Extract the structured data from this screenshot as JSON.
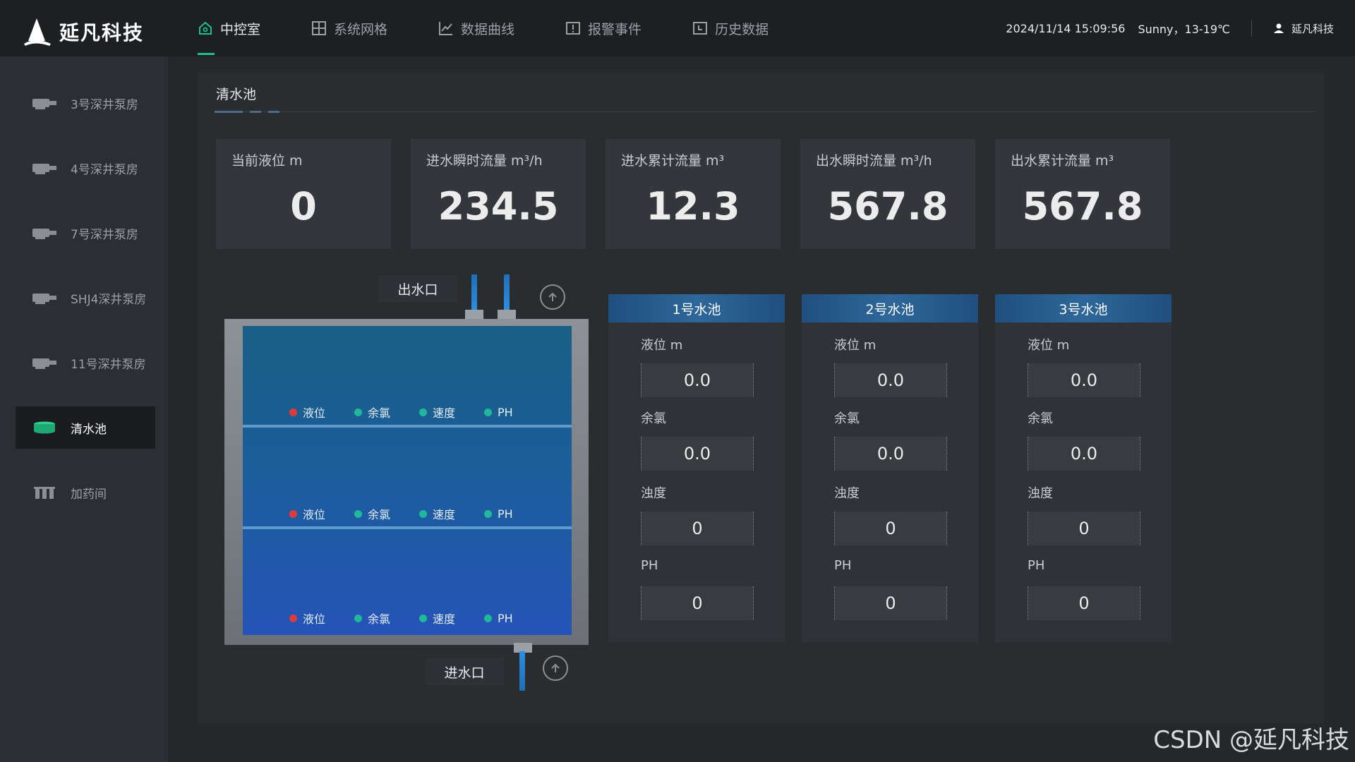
{
  "header": {
    "brand": "延凡科技",
    "nav": [
      {
        "label": "中控室",
        "icon": "home-icon",
        "active": true
      },
      {
        "label": "系统网格",
        "icon": "grid-icon",
        "active": false
      },
      {
        "label": "数据曲线",
        "icon": "line-chart-icon",
        "active": false
      },
      {
        "label": "报警事件",
        "icon": "alarm-icon",
        "active": false
      },
      {
        "label": "历史数据",
        "icon": "history-icon",
        "active": false
      }
    ],
    "datetime": "2024/11/14 15:09:56",
    "weather": "Sunny，13-19℃",
    "user": "延凡科技"
  },
  "sidebar": {
    "items": [
      {
        "label": "3号深井泵房",
        "icon": "pump-icon",
        "active": false
      },
      {
        "label": "4号深井泵房",
        "icon": "pump-icon",
        "active": false
      },
      {
        "label": "7号深井泵房",
        "icon": "pump-icon",
        "active": false
      },
      {
        "label": "SHJ4深井泵房",
        "icon": "pump-icon",
        "active": false
      },
      {
        "label": "11号深井泵房",
        "icon": "pump-icon",
        "active": false
      },
      {
        "label": "清水池",
        "icon": "pool-icon",
        "active": true
      },
      {
        "label": "加药间",
        "icon": "dosing-icon",
        "active": false
      }
    ]
  },
  "main": {
    "title": "清水池",
    "stats": [
      {
        "label": "当前液位 m",
        "value": "0"
      },
      {
        "label": "进水瞬时流量 m³/h",
        "value": "234.5"
      },
      {
        "label": "进水累计流量 m³",
        "value": "12.3"
      },
      {
        "label": "出水瞬时流量 m³/h",
        "value": "567.8"
      },
      {
        "label": "出水累计流量 m³",
        "value": "567.8"
      }
    ],
    "tank": {
      "outlet_label": "出水口",
      "inlet_label": "进水口",
      "legend": [
        "液位",
        "余氯",
        "速度",
        "PH"
      ]
    },
    "pools": [
      {
        "name": "1号水池",
        "metrics": [
          {
            "label": "液位 m",
            "value": "0.0"
          },
          {
            "label": "余氯",
            "value": "0.0"
          },
          {
            "label": "浊度",
            "value": "0"
          },
          {
            "label": "PH",
            "value": "0"
          }
        ]
      },
      {
        "name": "2号水池",
        "metrics": [
          {
            "label": "液位 m",
            "value": "0.0"
          },
          {
            "label": "余氯",
            "value": "0.0"
          },
          {
            "label": "浊度",
            "value": "0"
          },
          {
            "label": "PH",
            "value": "0"
          }
        ]
      },
      {
        "name": "3号水池",
        "metrics": [
          {
            "label": "液位 m",
            "value": "0.0"
          },
          {
            "label": "余氯",
            "value": "0.0"
          },
          {
            "label": "浊度",
            "value": "0"
          },
          {
            "label": "PH",
            "value": "0"
          }
        ]
      }
    ]
  },
  "watermark": "CSDN @延凡科技",
  "colors": {
    "accent": "#21c08b",
    "pool_header": "#2e679a",
    "legend_level": "#e03b3b",
    "legend_chlorine": "#1fb89a",
    "legend_speed": "#1fb89a",
    "legend_ph": "#1fb89a"
  }
}
